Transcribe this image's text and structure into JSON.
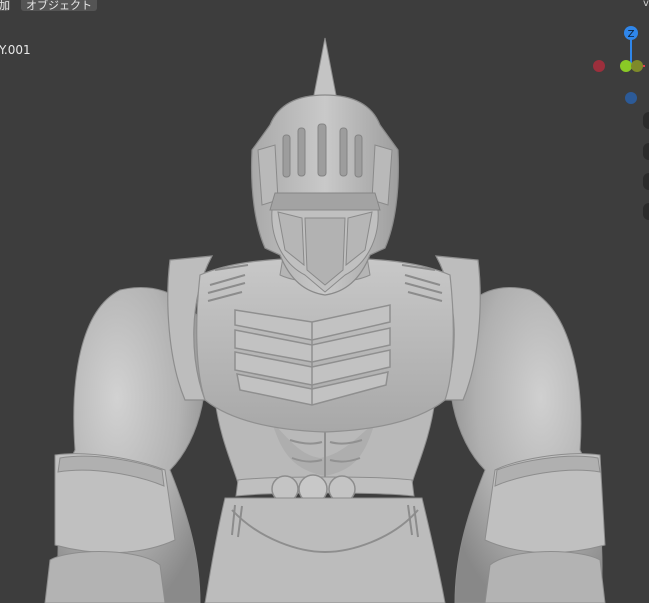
{
  "header": {
    "add_menu_label": "加",
    "object_menu_label": "オブジェクト"
  },
  "viewport": {
    "active_object_name": "Y.001",
    "background_color": "#3d3d3d",
    "model_color": "#bcbcbc"
  },
  "gizmo": {
    "z_axis_label": "Z",
    "x_axis_color": "#e0424f",
    "y_axis_color": "#8ac926",
    "z_axis_color": "#2f86ea",
    "neg_x_color": "#9c2f3c",
    "neg_z_color": "#2c5a97"
  },
  "icons": [
    "chevron-down-icon",
    "navigation-gizmo",
    "zoom-icon",
    "pan-icon",
    "camera-icon",
    "ortho-toggle-icon"
  ]
}
